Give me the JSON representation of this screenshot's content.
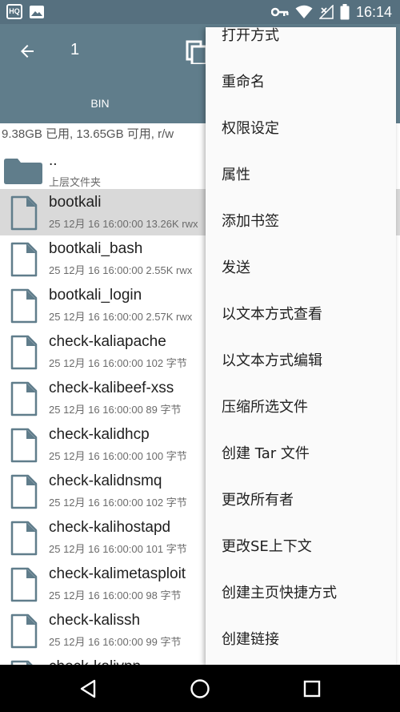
{
  "status_bar": {
    "time": "16:14",
    "left_icons": [
      "hq-icon",
      "image-icon"
    ],
    "right_icons": [
      "key-icon",
      "wifi-icon",
      "no-signal-icon",
      "battery-icon"
    ],
    "hq_label": "HQ"
  },
  "toolbar": {
    "title": "1",
    "tab_label": "BIN"
  },
  "storage_text": "9.38GB 已用, 13.65GB 可用, r/w",
  "files": [
    {
      "name": "..",
      "meta": "上层文件夹",
      "type": "folder"
    },
    {
      "name": "bootkali",
      "meta": "25 12月 16 16:00:00  13.26K  rwx",
      "type": "file",
      "selected": true
    },
    {
      "name": "bootkali_bash",
      "meta": "25 12月 16 16:00:00  2.55K  rwx",
      "type": "file"
    },
    {
      "name": "bootkali_login",
      "meta": "25 12月 16 16:00:00  2.57K  rwx",
      "type": "file"
    },
    {
      "name": "check-kaliapache",
      "meta": "25 12月 16 16:00:00  102 字节",
      "type": "file"
    },
    {
      "name": "check-kalibeef-xss",
      "meta": "25 12月 16 16:00:00  89 字节",
      "type": "file"
    },
    {
      "name": "check-kalidhcp",
      "meta": "25 12月 16 16:00:00  100 字节",
      "type": "file"
    },
    {
      "name": "check-kalidnsmq",
      "meta": "25 12月 16 16:00:00  102 字节",
      "type": "file"
    },
    {
      "name": "check-kalihostapd",
      "meta": "25 12月 16 16:00:00  101 字节",
      "type": "file"
    },
    {
      "name": "check-kalimetasploit",
      "meta": "25 12月 16 16:00:00  98 字节",
      "type": "file"
    },
    {
      "name": "check-kalissh",
      "meta": "25 12月 16 16:00:00  99 字节",
      "type": "file"
    },
    {
      "name": "check-kalivpn",
      "meta": "",
      "type": "file"
    }
  ],
  "menu": [
    "打开方式",
    "重命名",
    "权限设定",
    "属性",
    "添加书签",
    "发送",
    "以文本方式查看",
    "以文本方式编辑",
    "压缩所选文件",
    "创建 Tar 文件",
    "更改所有者",
    "更改SE上下文",
    "创建主页快捷方式",
    "创建链接"
  ],
  "nav": [
    "back-icon",
    "home-icon",
    "recents-icon"
  ],
  "colors": {
    "primary": "#607d8b",
    "primary_dark": "#56707f",
    "file_icon": "#607d8b",
    "selected_row": "#d9d9d9"
  }
}
